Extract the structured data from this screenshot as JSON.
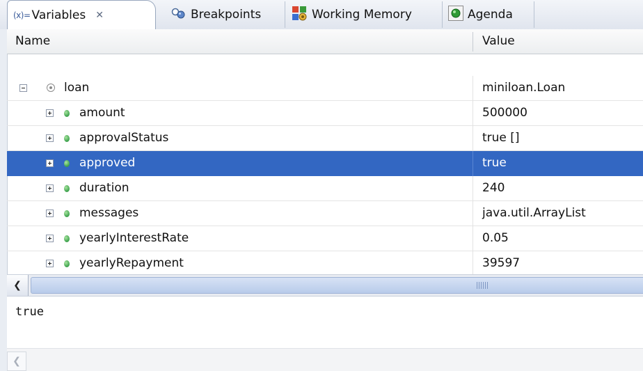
{
  "tabs": [
    {
      "label": "Variables",
      "glyph": "(x)=",
      "icon": "variables-icon",
      "active": true,
      "close": "✕"
    },
    {
      "label": "Breakpoints",
      "icon": "breakpoints-icon",
      "active": false
    },
    {
      "label": "Working Memory",
      "icon": "working-memory-icon",
      "active": false
    },
    {
      "label": "Agenda",
      "icon": "agenda-icon",
      "active": false
    }
  ],
  "table": {
    "columns": {
      "name": "Name",
      "value": "Value"
    },
    "rows": [
      {
        "name": "loan",
        "value": "miniloan.Loan",
        "level": 0,
        "expander": "collapse",
        "icon": "object-icon",
        "selected": false
      },
      {
        "name": "amount",
        "value": "500000",
        "level": 1,
        "expander": "expand",
        "icon": "field-icon",
        "selected": false
      },
      {
        "name": "approvalStatus",
        "value": "true []",
        "level": 1,
        "expander": "expand",
        "icon": "field-icon",
        "selected": false
      },
      {
        "name": "approved",
        "value": "true",
        "level": 1,
        "expander": "expand",
        "icon": "field-icon",
        "selected": true
      },
      {
        "name": "duration",
        "value": "240",
        "level": 1,
        "expander": "expand",
        "icon": "field-icon",
        "selected": false
      },
      {
        "name": "messages",
        "value": "java.util.ArrayList",
        "level": 1,
        "expander": "expand",
        "icon": "field-icon",
        "selected": false
      },
      {
        "name": "yearlyInterestRate",
        "value": "0.05",
        "level": 1,
        "expander": "expand",
        "icon": "field-icon",
        "selected": false
      },
      {
        "name": "yearlyRepayment",
        "value": "39597",
        "level": 1,
        "expander": "expand",
        "icon": "field-icon",
        "selected": false
      }
    ]
  },
  "details": {
    "text": "true"
  },
  "colors": {
    "selection": "#3367c2",
    "field_dot": "#3aa04a",
    "tab_border": "#98a7bd"
  }
}
